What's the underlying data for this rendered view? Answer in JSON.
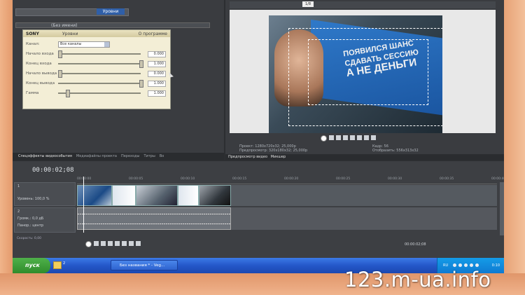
{
  "effects_panel": {
    "tab_labels": [
      "Спецэффекты видеособытия",
      "Уровни"
    ],
    "preset_value": "(Без имени)",
    "plugin": {
      "brand": "SONY",
      "name": "Уровни",
      "about": "О программе",
      "channel_label": "Канал:",
      "channel_value": "Все каналы",
      "params": [
        {
          "label": "Начало входа",
          "value": "0.000",
          "level": 0.0
        },
        {
          "label": "Конец входа",
          "value": "1.000",
          "level": 1.0
        },
        {
          "label": "Начало вывода",
          "value": "0.000",
          "level": 0.0
        },
        {
          "label": "Конец вывода",
          "value": "1.000",
          "level": 1.0
        },
        {
          "label": "Гамма",
          "value": "1.000",
          "level": 0.1
        }
      ]
    }
  },
  "dock_tabs": [
    "Спецэффекты видеособытия",
    "Медиафайлы проекта",
    "Переходы",
    "Титры",
    "Во"
  ],
  "preview": {
    "zoom": "1/8",
    "billboard_lines": [
      "ПОЯВИЛСЯ ШАНС",
      "СДАВАТЬ СЕССИЮ",
      "А НЕ ДЕНЬГИ"
    ],
    "info": {
      "project_label": "Проект:",
      "project_value": "1280x720x32; 25,000p",
      "preview_label": "Предпросмотр:",
      "preview_value": "320x180x32; 25,000p",
      "frame_label": "Кадр:",
      "frame_value": "56",
      "display_label": "Отобразить:",
      "display_value": "556x313x32"
    },
    "tabs": [
      "Предпросмотр видео",
      "Микшер"
    ]
  },
  "timeline": {
    "timecode": "00:00:02;08",
    "ruler": [
      "00:00:00",
      "00:00:05",
      "00:00:10",
      "00:00:15",
      "00:00:20",
      "00:00:25",
      "00:00:30",
      "00:00:35",
      "00:00:40"
    ],
    "track_labels": [
      "Уровень: 100,0 %",
      "Громк.: 0,0 дБ",
      "Панор.: центр"
    ],
    "rate_label": "Скорость: 0,00",
    "end_timecode": "00:00:02;08",
    "track_numbers": [
      "1",
      "2"
    ]
  },
  "taskbar": {
    "start_label": "пуск",
    "folder_count": "2",
    "task_label": "Без названия * - Veg...",
    "lang": "RU",
    "clock": "0:10"
  },
  "watermark": "123.m-ua.info",
  "colors": {
    "bezel": "#e9a57a",
    "app_background": "#3a3c40",
    "taskbar": "#2457c9",
    "start_button": "#2f8c2c",
    "billboard": "#2f79c9"
  }
}
